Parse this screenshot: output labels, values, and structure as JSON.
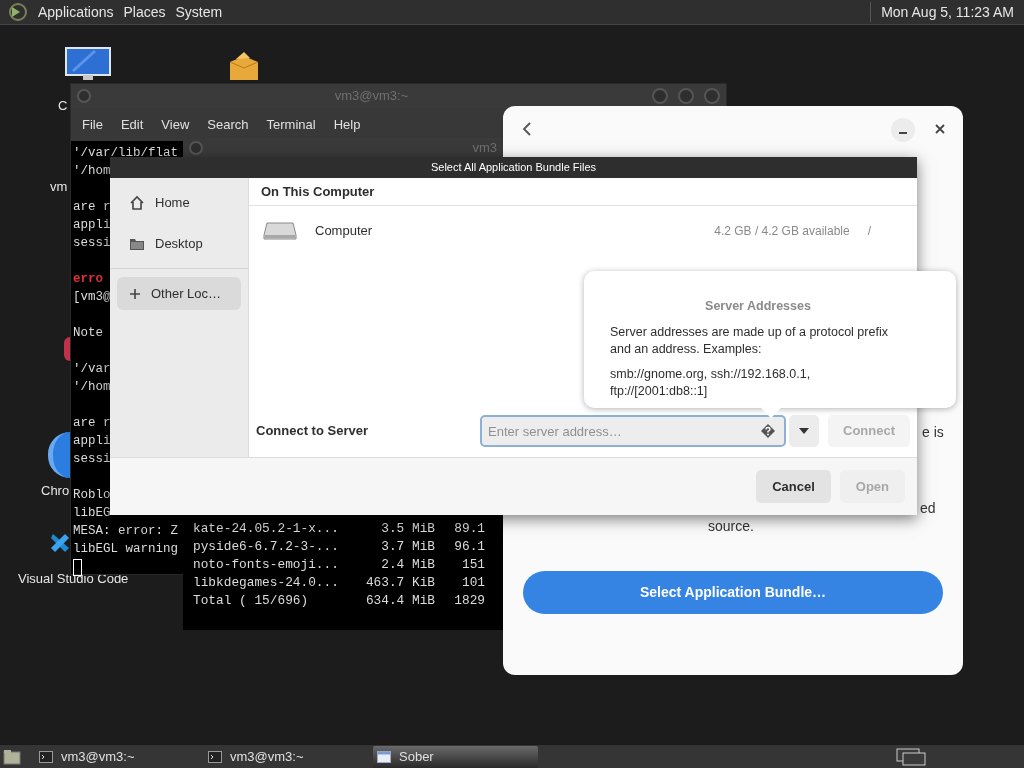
{
  "top_panel": {
    "menus": [
      "Applications",
      "Places",
      "System"
    ],
    "clock": "Mon Aug 5, 11:23 AM"
  },
  "desktop_items": [
    {
      "kind": "monitor",
      "label": "C"
    },
    {
      "kind": "package"
    },
    {
      "kind": "hidden",
      "label": "vm"
    },
    {
      "kind": "red-app"
    },
    {
      "kind": "chrome",
      "label": "Chro"
    },
    {
      "kind": "vscode",
      "label": "Visual Studio Code"
    }
  ],
  "terminal_back": {
    "title": "vm3@vm3:~",
    "menu": [
      "File",
      "Edit",
      "View",
      "Search",
      "Terminal",
      "Help"
    ],
    "lines": [
      {
        "text": "'/var/lib/flat",
        "kind": "output",
        "blank_before": false
      },
      {
        "text": "'/hom",
        "kind": "output",
        "blank_before": false
      },
      {
        "text": "are r",
        "kind": "output",
        "blank_before": true
      },
      {
        "text": "appli",
        "kind": "output",
        "blank_before": false
      },
      {
        "text": "sessi",
        "kind": "output",
        "blank_before": false
      },
      {
        "text": "erro",
        "kind": "error",
        "blank_before": true
      },
      {
        "text": "[vm3@",
        "kind": "output",
        "blank_before": false
      },
      {
        "text": "Note",
        "kind": "output",
        "blank_before": true
      },
      {
        "text": "'/var",
        "kind": "output",
        "blank_before": true
      },
      {
        "text": "'/hom",
        "kind": "output",
        "blank_before": false
      },
      {
        "text": "are r",
        "kind": "output",
        "blank_before": true
      },
      {
        "text": "appli",
        "kind": "output",
        "blank_before": false
      },
      {
        "text": "sessi",
        "kind": "output",
        "blank_before": false
      },
      {
        "text": "Roblo",
        "kind": "output",
        "blank_before": true
      },
      {
        "text": "libEG",
        "kind": "output",
        "blank_before": false
      },
      {
        "text": "MESA: error: Z",
        "kind": "output",
        "blank_before": false
      },
      {
        "text": "libEGL warning",
        "kind": "output",
        "blank_before": false
      }
    ]
  },
  "terminal_front": {
    "title": "vm3",
    "rows": [
      {
        "name": "kate-24.05.2-1-x...",
        "size": "3.5 MiB",
        "rate": "89.1"
      },
      {
        "name": "pyside6-6.7.2-3-...",
        "size": "3.7 MiB",
        "rate": "96.1"
      },
      {
        "name": "noto-fonts-emoji...",
        "size": "2.4 MiB",
        "rate": "151"
      },
      {
        "name": "libkdegames-24.0...",
        "size": "463.7 KiB",
        "rate": "101"
      },
      {
        "name": "Total ( 15/696)",
        "size": "634.4 MiB",
        "rate": "1829"
      }
    ]
  },
  "sober_window": {
    "fragments": [
      "e is",
      "ed",
      "source."
    ],
    "button": "Select Application Bundle…"
  },
  "file_dialog": {
    "title": "Select All Application Bundle Files",
    "sidebar": [
      {
        "label": "Home",
        "kind": "home",
        "selected": false
      },
      {
        "label": "Desktop",
        "kind": "folder",
        "selected": false
      },
      {
        "label": "Other Loc…",
        "kind": "plus",
        "selected": true
      }
    ],
    "section_title": "On This Computer",
    "locations": [
      {
        "name": "Computer",
        "usage": "4.2 GB / 4.2 GB available",
        "mount": "/"
      }
    ],
    "connect_label": "Connect to Server",
    "server_field": {
      "placeholder": "Enter server address…"
    },
    "connect_button": {
      "label": "Connect",
      "disabled": true
    },
    "buttons": [
      {
        "label": "Cancel",
        "disabled": false
      },
      {
        "label": "Open",
        "disabled": true
      }
    ],
    "popover": {
      "title": "Server Addresses",
      "paragraphs": [
        "Server addresses are made up of a protocol prefix and an address. Examples:",
        "smb://gnome.org, ssh://192.168.0.1, ftp://[2001:db8::1]"
      ]
    }
  },
  "taskbar": {
    "tasks": [
      {
        "label": "vm3@vm3:~",
        "kind": "terminal",
        "selected": false
      },
      {
        "label": "vm3@vm3:~",
        "kind": "terminal",
        "selected": false
      },
      {
        "label": "Sober",
        "kind": "window",
        "selected": true
      }
    ]
  }
}
